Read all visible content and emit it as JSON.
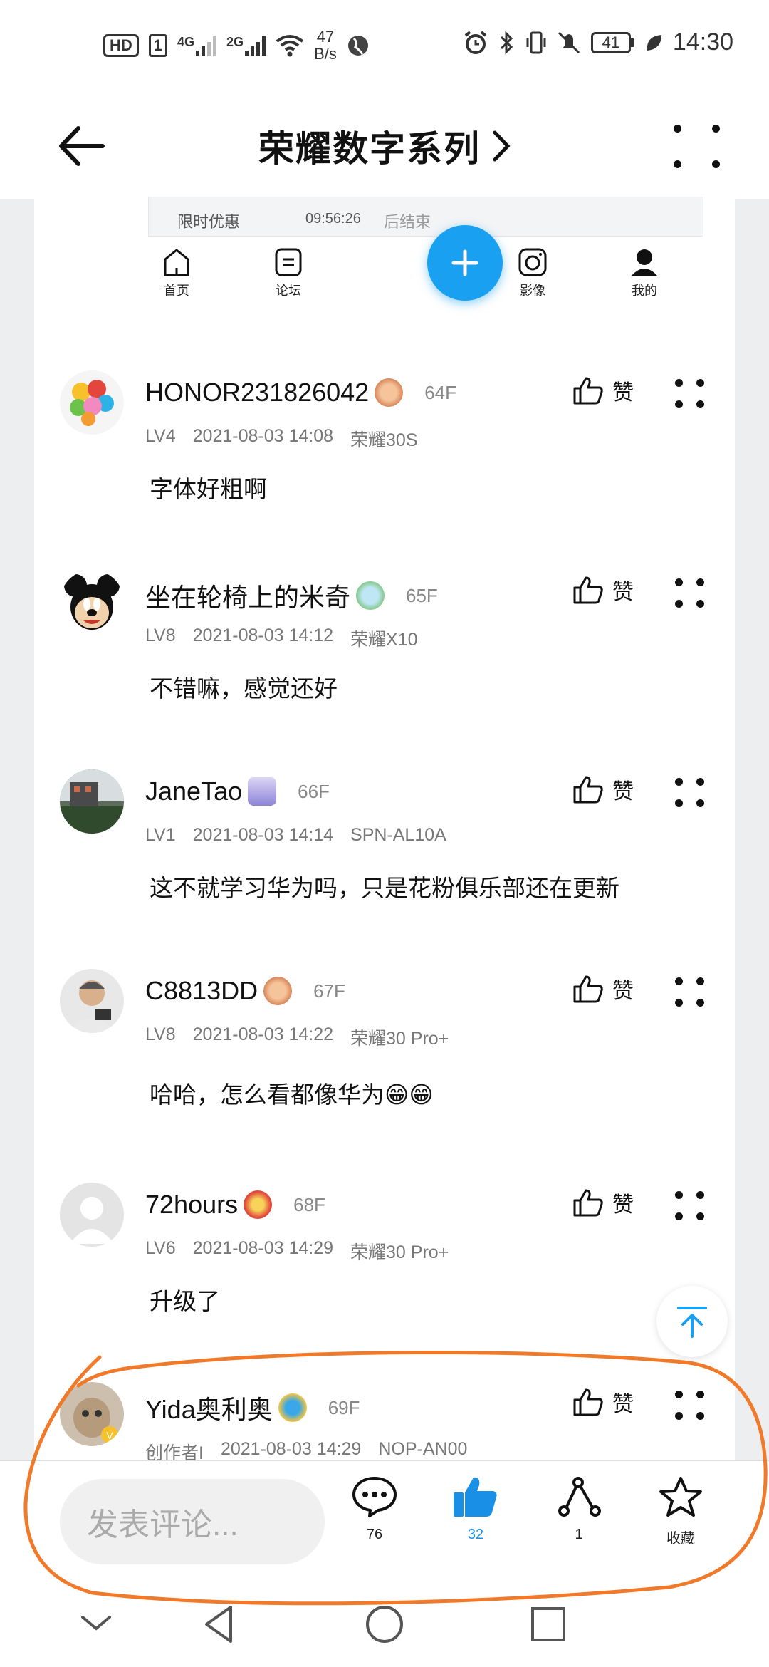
{
  "status_bar": {
    "hd": "HD",
    "sim1": "4G",
    "sim2": "2G",
    "speed_value": "47",
    "speed_unit": "B/s",
    "battery": "41",
    "time": "14:30"
  },
  "header": {
    "title": "荣耀数字系列",
    "chevron": ">"
  },
  "embed": {
    "promo_text": "限时优惠",
    "countdown": "09:56:26",
    "promo_suffix": "后结束",
    "nav": [
      {
        "label": "首页",
        "icon": "home-icon"
      },
      {
        "label": "论坛",
        "icon": "forum-icon"
      },
      {
        "label": "影像",
        "icon": "camera-icon"
      },
      {
        "label": "我的",
        "icon": "profile-icon"
      }
    ],
    "fab_icon": "plus-icon"
  },
  "comments": [
    {
      "user": "HONOR231826042",
      "floor": "64F",
      "level": "LV4",
      "time": "2021-08-03 14:08",
      "device": "荣耀30S",
      "text": "字体好粗啊",
      "like_label": "赞"
    },
    {
      "user": "坐在轮椅上的米奇",
      "floor": "65F",
      "level": "LV8",
      "time": "2021-08-03 14:12",
      "device": "荣耀X10",
      "text": "不错嘛，感觉还好",
      "like_label": "赞"
    },
    {
      "user": "JaneTao",
      "floor": "66F",
      "level": "LV1",
      "time": "2021-08-03 14:14",
      "device": "SPN-AL10A",
      "text": "这不就学习华为吗，只是花粉俱乐部还在更新",
      "like_label": "赞"
    },
    {
      "user": "C8813DD",
      "floor": "67F",
      "level": "LV8",
      "time": "2021-08-03 14:22",
      "device": "荣耀30 Pro+",
      "text": "哈哈，怎么看都像华为😁😁",
      "like_label": "赞"
    },
    {
      "user": "72hours",
      "floor": "68F",
      "level": "LV6",
      "time": "2021-08-03 14:29",
      "device": "荣耀30 Pro+",
      "text": "升级了",
      "like_label": "赞"
    },
    {
      "user": "Yida奥利奥",
      "floor": "69F",
      "level": "创作者I",
      "time": "2021-08-03 14:29",
      "device": "NOP-AN00",
      "text": "",
      "like_label": "赞"
    }
  ],
  "bottom_bar": {
    "input_placeholder": "发表评论...",
    "comments_count": "76",
    "likes_count": "32",
    "shares_count": "1",
    "favorite_label": "收藏"
  },
  "colors": {
    "accent": "#1aa0f0",
    "like_active": "#1a8fe6",
    "annotation": "#f07a2a"
  }
}
